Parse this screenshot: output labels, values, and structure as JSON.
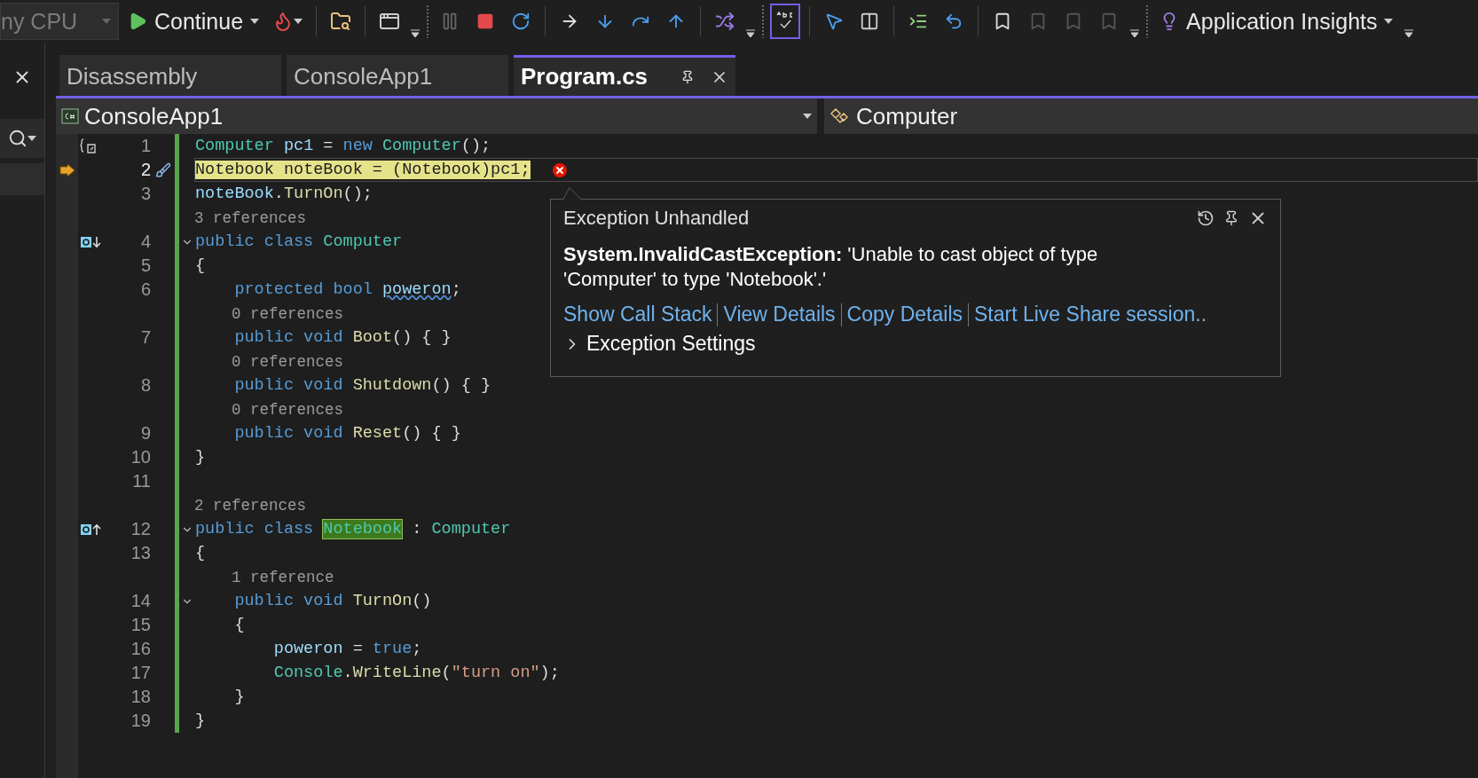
{
  "toolbar": {
    "platform": "ny CPU",
    "continue": "Continue",
    "insights": "Application Insights",
    "spell_check_on": true
  },
  "tabs": [
    {
      "label": "Disassembly",
      "selected": false
    },
    {
      "label": "ConsoleApp1",
      "selected": false
    },
    {
      "label": "Program.cs",
      "selected": true
    }
  ],
  "nav": {
    "project": "ConsoleApp1",
    "member": "Computer"
  },
  "editor": {
    "lines": [
      {
        "kind": "code",
        "number": "1",
        "gutter_icon": {
          "kind": "scope"
        },
        "tokens": [
          {
            "text": "Computer ",
            "kind": "type"
          },
          {
            "text": "pc1",
            "kind": "ident"
          },
          {
            "text": " = ",
            "kind": "plain"
          },
          {
            "text": "new ",
            "kind": "kw"
          },
          {
            "text": "Computer",
            "kind": "type"
          },
          {
            "text": "();",
            "kind": "plain"
          }
        ]
      },
      {
        "kind": "code",
        "number": "2",
        "current": true,
        "error": true,
        "tokens": [
          {
            "text": "Notebook ",
            "kind": "type"
          },
          {
            "text": "noteBook",
            "kind": "ident"
          },
          {
            "text": " = (",
            "kind": "plain"
          },
          {
            "text": "Notebook",
            "kind": "type"
          },
          {
            "text": ")",
            "kind": "plain"
          },
          {
            "text": "pc1",
            "kind": "ident"
          },
          {
            "text": ";",
            "kind": "plain"
          }
        ]
      },
      {
        "kind": "code",
        "number": "3",
        "tokens": [
          {
            "text": "noteBook",
            "kind": "ident"
          },
          {
            "text": ".",
            "kind": "plain"
          },
          {
            "text": "TurnOn",
            "kind": "method"
          },
          {
            "text": "();",
            "kind": "plain"
          }
        ]
      },
      {
        "kind": "lens",
        "text": "3 references"
      },
      {
        "kind": "code",
        "number": "4",
        "gutter_icon": {
          "kind": "implemented"
        },
        "collapsible": true,
        "tokens": [
          {
            "text": "public class ",
            "kind": "kw"
          },
          {
            "text": "Computer",
            "kind": "type"
          }
        ]
      },
      {
        "kind": "code",
        "number": "5",
        "tokens": [
          {
            "text": "{",
            "kind": "plain"
          }
        ]
      },
      {
        "kind": "code",
        "number": "6",
        "tokens": [
          {
            "text": "    protected bool ",
            "kind": "kw"
          },
          {
            "text": "poweron",
            "kind": "ident",
            "squiggle": true
          },
          {
            "text": ";",
            "kind": "plain"
          }
        ]
      },
      {
        "kind": "lens",
        "text": "    0 references"
      },
      {
        "kind": "code",
        "number": "7",
        "tokens": [
          {
            "text": "    public void ",
            "kind": "kw"
          },
          {
            "text": "Boot",
            "kind": "method"
          },
          {
            "text": "() { }",
            "kind": "plain"
          }
        ]
      },
      {
        "kind": "lens",
        "text": "    0 references"
      },
      {
        "kind": "code",
        "number": "8",
        "tokens": [
          {
            "text": "    public void ",
            "kind": "kw"
          },
          {
            "text": "Shutdown",
            "kind": "method"
          },
          {
            "text": "() { }",
            "kind": "plain"
          }
        ]
      },
      {
        "kind": "lens",
        "text": "    0 references"
      },
      {
        "kind": "code",
        "number": "9",
        "tokens": [
          {
            "text": "    public void ",
            "kind": "kw"
          },
          {
            "text": "Reset",
            "kind": "method"
          },
          {
            "text": "() { }",
            "kind": "plain"
          }
        ]
      },
      {
        "kind": "code",
        "number": "10",
        "tokens": [
          {
            "text": "}",
            "kind": "plain"
          }
        ]
      },
      {
        "kind": "code",
        "number": "11"
      },
      {
        "kind": "lens",
        "text": "2 references"
      },
      {
        "kind": "code",
        "number": "12",
        "gutter_icon": {
          "kind": "implements"
        },
        "collapsible": true,
        "tokens": [
          {
            "text": "public class ",
            "kind": "kw"
          },
          {
            "text": "Notebook",
            "kind": "type",
            "highlight": true
          },
          {
            "text": " : ",
            "kind": "plain"
          },
          {
            "text": "Computer",
            "kind": "type"
          }
        ]
      },
      {
        "kind": "code",
        "number": "13",
        "tokens": [
          {
            "text": "{",
            "kind": "plain"
          }
        ]
      },
      {
        "kind": "lens",
        "text": "    1 reference"
      },
      {
        "kind": "code",
        "number": "14",
        "collapsible": true,
        "tokens": [
          {
            "text": "    public void ",
            "kind": "kw"
          },
          {
            "text": "TurnOn",
            "kind": "method"
          },
          {
            "text": "()",
            "kind": "plain"
          }
        ]
      },
      {
        "kind": "code",
        "number": "15",
        "tokens": [
          {
            "text": "    {",
            "kind": "plain"
          }
        ]
      },
      {
        "kind": "code",
        "number": "16",
        "tokens": [
          {
            "text": "        poweron",
            "kind": "ident"
          },
          {
            "text": " = ",
            "kind": "plain"
          },
          {
            "text": "true",
            "kind": "kw"
          },
          {
            "text": ";",
            "kind": "plain"
          }
        ]
      },
      {
        "kind": "code",
        "number": "17",
        "tokens": [
          {
            "text": "        Console",
            "kind": "type"
          },
          {
            "text": ".",
            "kind": "plain"
          },
          {
            "text": "WriteLine",
            "kind": "method"
          },
          {
            "text": "(",
            "kind": "plain"
          },
          {
            "text": "\"turn on\"",
            "kind": "string"
          },
          {
            "text": ");",
            "kind": "plain"
          }
        ]
      },
      {
        "kind": "code",
        "number": "18",
        "tokens": [
          {
            "text": "    }",
            "kind": "plain"
          }
        ]
      },
      {
        "kind": "code",
        "number": "19",
        "tokens": [
          {
            "text": "}",
            "kind": "plain"
          }
        ]
      }
    ]
  },
  "exception": {
    "title": "Exception Unhandled",
    "message": "**System.InvalidCastException:** 'Unable to cast object of type 'Computer' to type 'Notebook'.'",
    "links": [
      "Show Call Stack",
      "View Details",
      "Copy Details",
      "Start Live Share session.."
    ],
    "settings": "Exception Settings",
    "settings_expanded": false
  }
}
